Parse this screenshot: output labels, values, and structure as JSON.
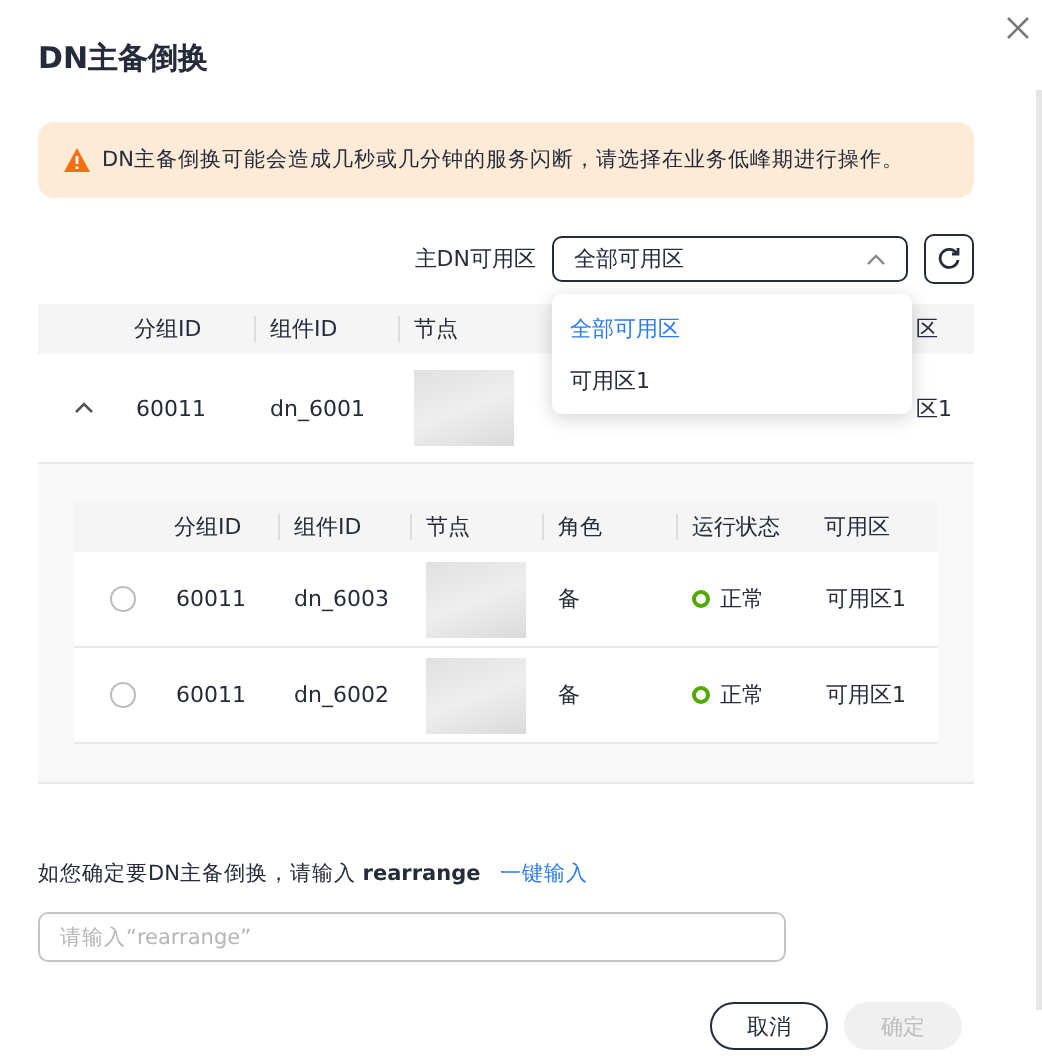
{
  "dialog": {
    "title": "DN主备倒换"
  },
  "alert": {
    "text": "DN主备倒换可能会造成几秒或几分钟的服务闪断，请选择在业务低峰期进行操作。"
  },
  "filter": {
    "label": "主DN可用区",
    "value": "全部可用区",
    "expanded": true,
    "options": [
      {
        "label": "全部可用区",
        "selected": true
      },
      {
        "label": "可用区1",
        "selected": false
      }
    ]
  },
  "table": {
    "columns": [
      "分组ID",
      "组件ID",
      "节点",
      "区"
    ],
    "rows": [
      {
        "expanded": true,
        "group_id": "60011",
        "component_id": "dn_6001",
        "zone": "区1",
        "children": {
          "columns": [
            "分组ID",
            "组件ID",
            "节点",
            "角色",
            "运行状态",
            "可用区"
          ],
          "rows": [
            {
              "selected": false,
              "group_id": "60011",
              "component_id": "dn_6003",
              "role": "备",
              "status": "正常",
              "zone": "可用区1"
            },
            {
              "selected": false,
              "group_id": "60011",
              "component_id": "dn_6002",
              "role": "备",
              "status": "正常",
              "zone": "可用区1"
            }
          ]
        }
      }
    ]
  },
  "confirm": {
    "prompt": "如您确定要DN主备倒换，请输入 **rearrange**",
    "link": "一键输入",
    "placeholder": "请输入“rearrange”"
  },
  "buttons": [
    {
      "label": "取消",
      "disabled": false
    },
    {
      "label": "确定",
      "disabled": true
    }
  ]
}
